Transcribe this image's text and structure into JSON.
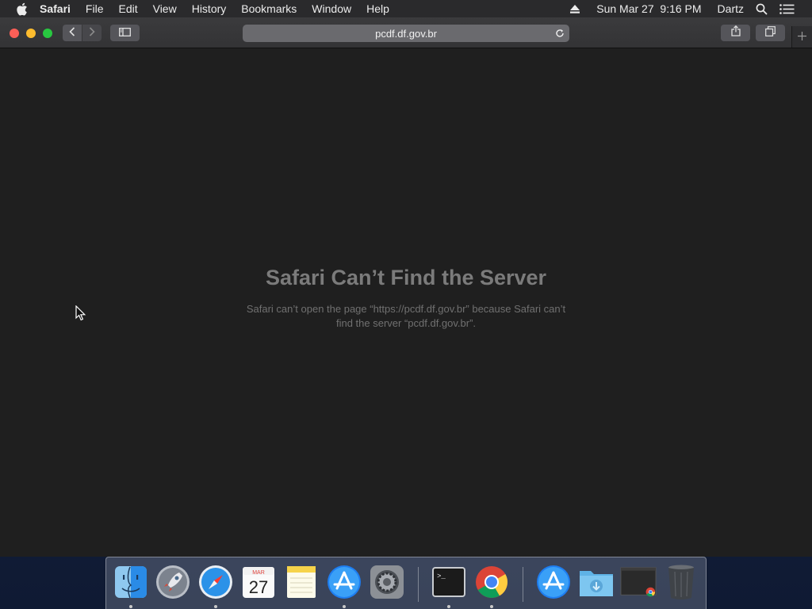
{
  "menubar": {
    "app_name": "Safari",
    "items": [
      "File",
      "Edit",
      "View",
      "History",
      "Bookmarks",
      "Window",
      "Help"
    ],
    "clock": "Sun Mar 27  9:16 PM",
    "user": "Dartz",
    "icons": [
      "apple-icon",
      "eject-icon",
      "spotlight-search-icon",
      "notification-list-icon"
    ]
  },
  "browser": {
    "url": "pcdf.df.gov.br",
    "icons": [
      "back-icon",
      "forward-icon",
      "sidebar-icon",
      "reload-icon",
      "share-icon",
      "tabs-overview-icon",
      "new-tab-icon"
    ]
  },
  "error": {
    "title": "Safari Can’t Find the Server",
    "message_line1": "Safari can’t open the page “https://pcdf.df.gov.br” because Safari can’t",
    "message_line2": "find the server “pcdf.df.gov.br”."
  },
  "dock": {
    "items": [
      {
        "name": "finder-icon",
        "running": true
      },
      {
        "name": "launchpad-icon",
        "running": false
      },
      {
        "name": "safari-icon",
        "running": true
      },
      {
        "name": "calendar-icon",
        "running": false,
        "month": "MAR",
        "day": "27"
      },
      {
        "name": "notes-icon",
        "running": false
      },
      {
        "name": "app-store-icon",
        "running": true
      },
      {
        "name": "system-preferences-icon",
        "running": false
      },
      {
        "name": "terminal-icon",
        "running": true,
        "prompt": ">_"
      },
      {
        "name": "chrome-icon",
        "running": true
      },
      {
        "name": "applications-folder-icon",
        "running": false
      },
      {
        "name": "downloads-folder-icon",
        "running": false
      },
      {
        "name": "chrome-window-thumbnail-icon",
        "running": false
      },
      {
        "name": "trash-icon",
        "running": false
      }
    ]
  },
  "colors": {
    "close": "#fc5f57",
    "minimize": "#fdbc2e",
    "maximize": "#28c840",
    "content_background": "#1f1f1f"
  }
}
